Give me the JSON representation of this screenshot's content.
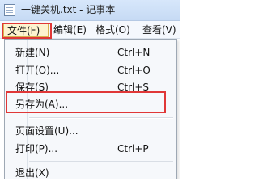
{
  "window": {
    "title": "一键关机.txt - 记事本",
    "icon": "notepad-icon"
  },
  "menubar": {
    "file": "文件(F)",
    "edit": "编辑(E)",
    "format": "格式(O)",
    "view": "查看(V)"
  },
  "file_menu": {
    "items": [
      {
        "label": "新建(N)",
        "shortcut": "Ctrl+N"
      },
      {
        "label": "打开(O)...",
        "shortcut": "Ctrl+O"
      },
      {
        "label": "保存(S)",
        "shortcut": "Ctrl+S"
      },
      {
        "label": "另存为(A)...",
        "shortcut": ""
      },
      {
        "label": "页面设置(U)...",
        "shortcut": ""
      },
      {
        "label": "打印(P)...",
        "shortcut": "Ctrl+P"
      },
      {
        "label": "退出(X)",
        "shortcut": ""
      }
    ]
  },
  "colors": {
    "annotation_red": "#e03737",
    "active_menu_bg": "#fdf3cf",
    "active_menu_border": "#d8b24f"
  }
}
